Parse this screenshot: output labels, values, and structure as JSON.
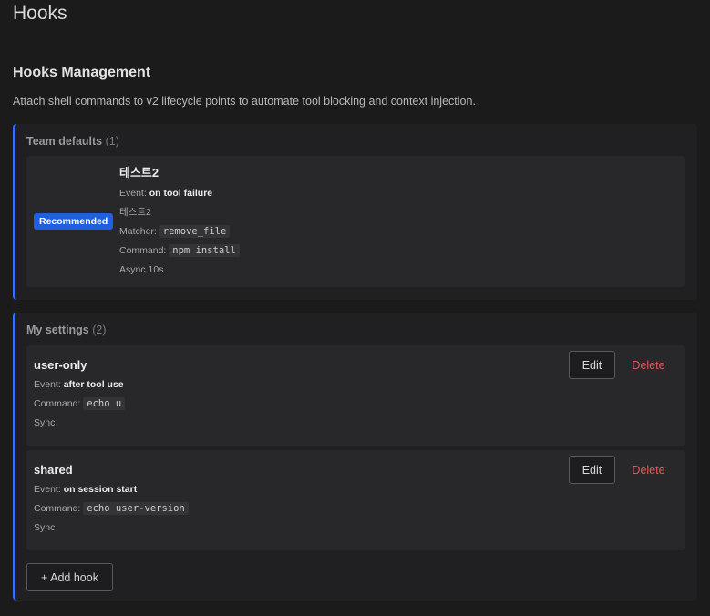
{
  "page": {
    "title": "Hooks"
  },
  "section": {
    "title": "Hooks Management",
    "description": "Attach shell commands to v2 lifecycle points to automate tool blocking and context injection."
  },
  "team_defaults": {
    "label": "Team defaults",
    "count": "(1)",
    "hooks": [
      {
        "badge": "Recommended",
        "name": "테스트2",
        "event_label": "Event:",
        "event": "on tool failure",
        "description": "테스트2",
        "matcher_label": "Matcher:",
        "matcher": "remove_file",
        "command_label": "Command:",
        "command": "npm install",
        "mode": "Async 10s"
      }
    ]
  },
  "my_settings": {
    "label": "My settings",
    "count": "(2)",
    "hooks": [
      {
        "name": "user-only",
        "event_label": "Event:",
        "event": "after tool use",
        "command_label": "Command:",
        "command": "echo u",
        "mode": "Sync",
        "edit_label": "Edit",
        "delete_label": "Delete"
      },
      {
        "name": "shared",
        "event_label": "Event:",
        "event": "on session start",
        "command_label": "Command:",
        "command": "echo user-version",
        "mode": "Sync",
        "edit_label": "Edit",
        "delete_label": "Delete"
      }
    ],
    "add_label": "+ Add hook"
  },
  "colors": {
    "accent": "#3b6ef5",
    "badge": "#1f5fe0",
    "danger": "#e25a5a",
    "background": "#1b1b1c"
  }
}
